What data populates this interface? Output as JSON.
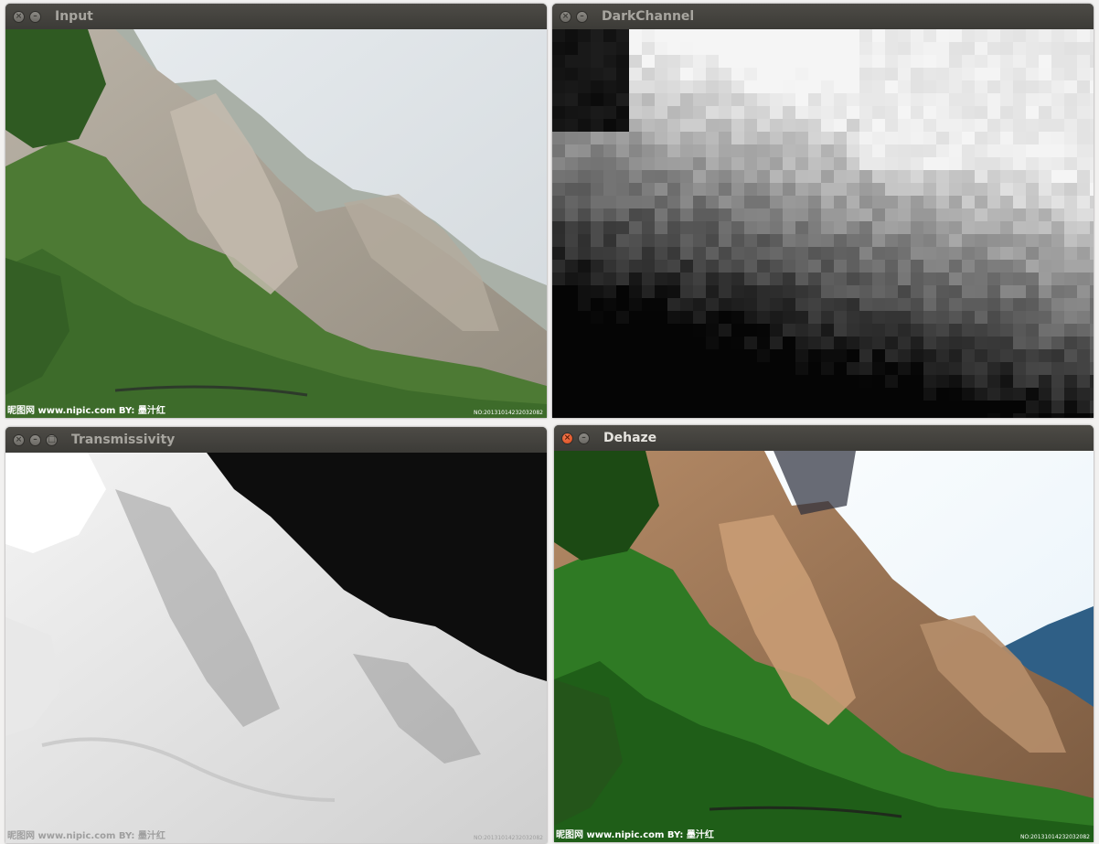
{
  "windows": [
    {
      "key": "input",
      "title": "Input",
      "active": false,
      "buttons": [
        "×",
        "–"
      ]
    },
    {
      "key": "dark",
      "title": "DarkChannel",
      "active": false,
      "buttons": [
        "×",
        "–"
      ]
    },
    {
      "key": "trans",
      "title": "Transmissivity",
      "active": false,
      "buttons": [
        "×",
        "–",
        "□"
      ]
    },
    {
      "key": "dehaze",
      "title": "Dehaze",
      "active": true,
      "buttons": [
        "×",
        "–"
      ]
    }
  ],
  "watermark": {
    "left": "昵图网 www.nipic.com   BY: 墨汁红",
    "right": "NO:20131014232032082"
  },
  "colors": {
    "titlebar": "#3c3b37",
    "close_active": "#e0532a",
    "title_active": "#e6e4df",
    "title_inactive": "#a7a59f"
  }
}
